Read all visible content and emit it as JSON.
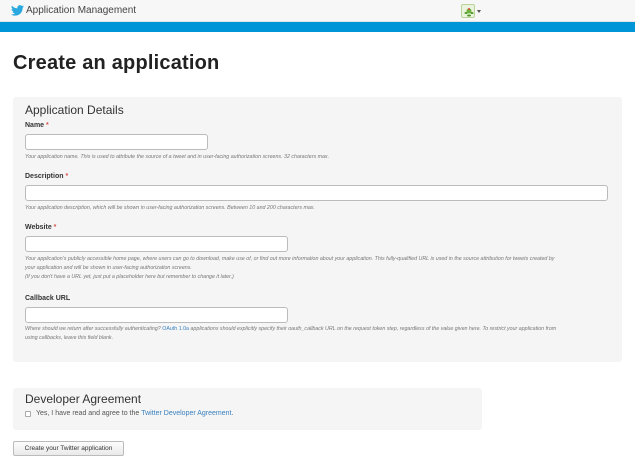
{
  "header": {
    "app_title": "Application Management",
    "logo_icon": "twitter-bird-icon",
    "avatar_icon": "user-avatar-icon",
    "brand_color": "#0095d7"
  },
  "page": {
    "title": "Create an application"
  },
  "details": {
    "legend": "Application Details",
    "name": {
      "label": "Name",
      "required_mark": "*",
      "value": "",
      "help": "Your application name. This is used to attribute the source of a tweet and in user-facing authorization screens. 32 characters max."
    },
    "description": {
      "label": "Description",
      "required_mark": "*",
      "value": "",
      "help": "Your application description, which will be shown in user-facing authorization screens. Between 10 and 200 characters max."
    },
    "website": {
      "label": "Website",
      "required_mark": "*",
      "value": "",
      "help_line1": "Your application's publicly accessible home page, where users can go to download, make use of, or find out more information about your application. This fully-qualified URL is used in the source attribution for tweets created by",
      "help_line2": "your application and will be shown in user-facing authorization screens.",
      "help_line3": "(If you don't have a URL yet, just put a placeholder here but remember to change it later.)"
    },
    "callback": {
      "label": "Callback URL",
      "value": "",
      "help_pre": "Where should we return after successfully authenticating? ",
      "help_link": "OAuth 1.0a",
      "help_post": " applications should explicitly specify their oauth_callback URL on the request token step, regardless of the value given here. To restrict your application from",
      "help_line2": "using callbacks, leave this field blank."
    }
  },
  "agreement": {
    "legend": "Developer Agreement",
    "checkbox_label": "Yes, I have read and agree to the ",
    "link_text": "Twitter Developer Agreement",
    "suffix": ".",
    "checked": false
  },
  "submit_label": "Create your Twitter application"
}
